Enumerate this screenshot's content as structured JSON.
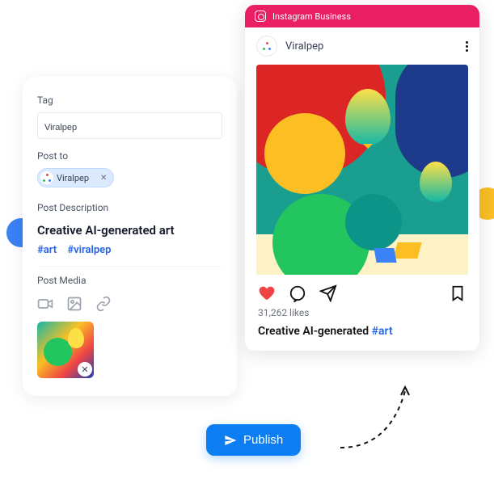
{
  "compose": {
    "tag_label": "Tag",
    "tag_value": "Viralpep",
    "post_to_label": "Post to",
    "post_to_pill": "Viralpep",
    "description_label": "Post Description",
    "description_text": "Creative AI-generated art",
    "hashtag1": "#art",
    "hashtag2": "#viralpep",
    "media_label": "Post Media"
  },
  "preview": {
    "platform": "Instagram Business",
    "account": "Viralpep",
    "likes": "31,262 likes",
    "caption_text": "Creative AI-generated ",
    "caption_hash": "#art"
  },
  "actions": {
    "publish": "Publish"
  }
}
